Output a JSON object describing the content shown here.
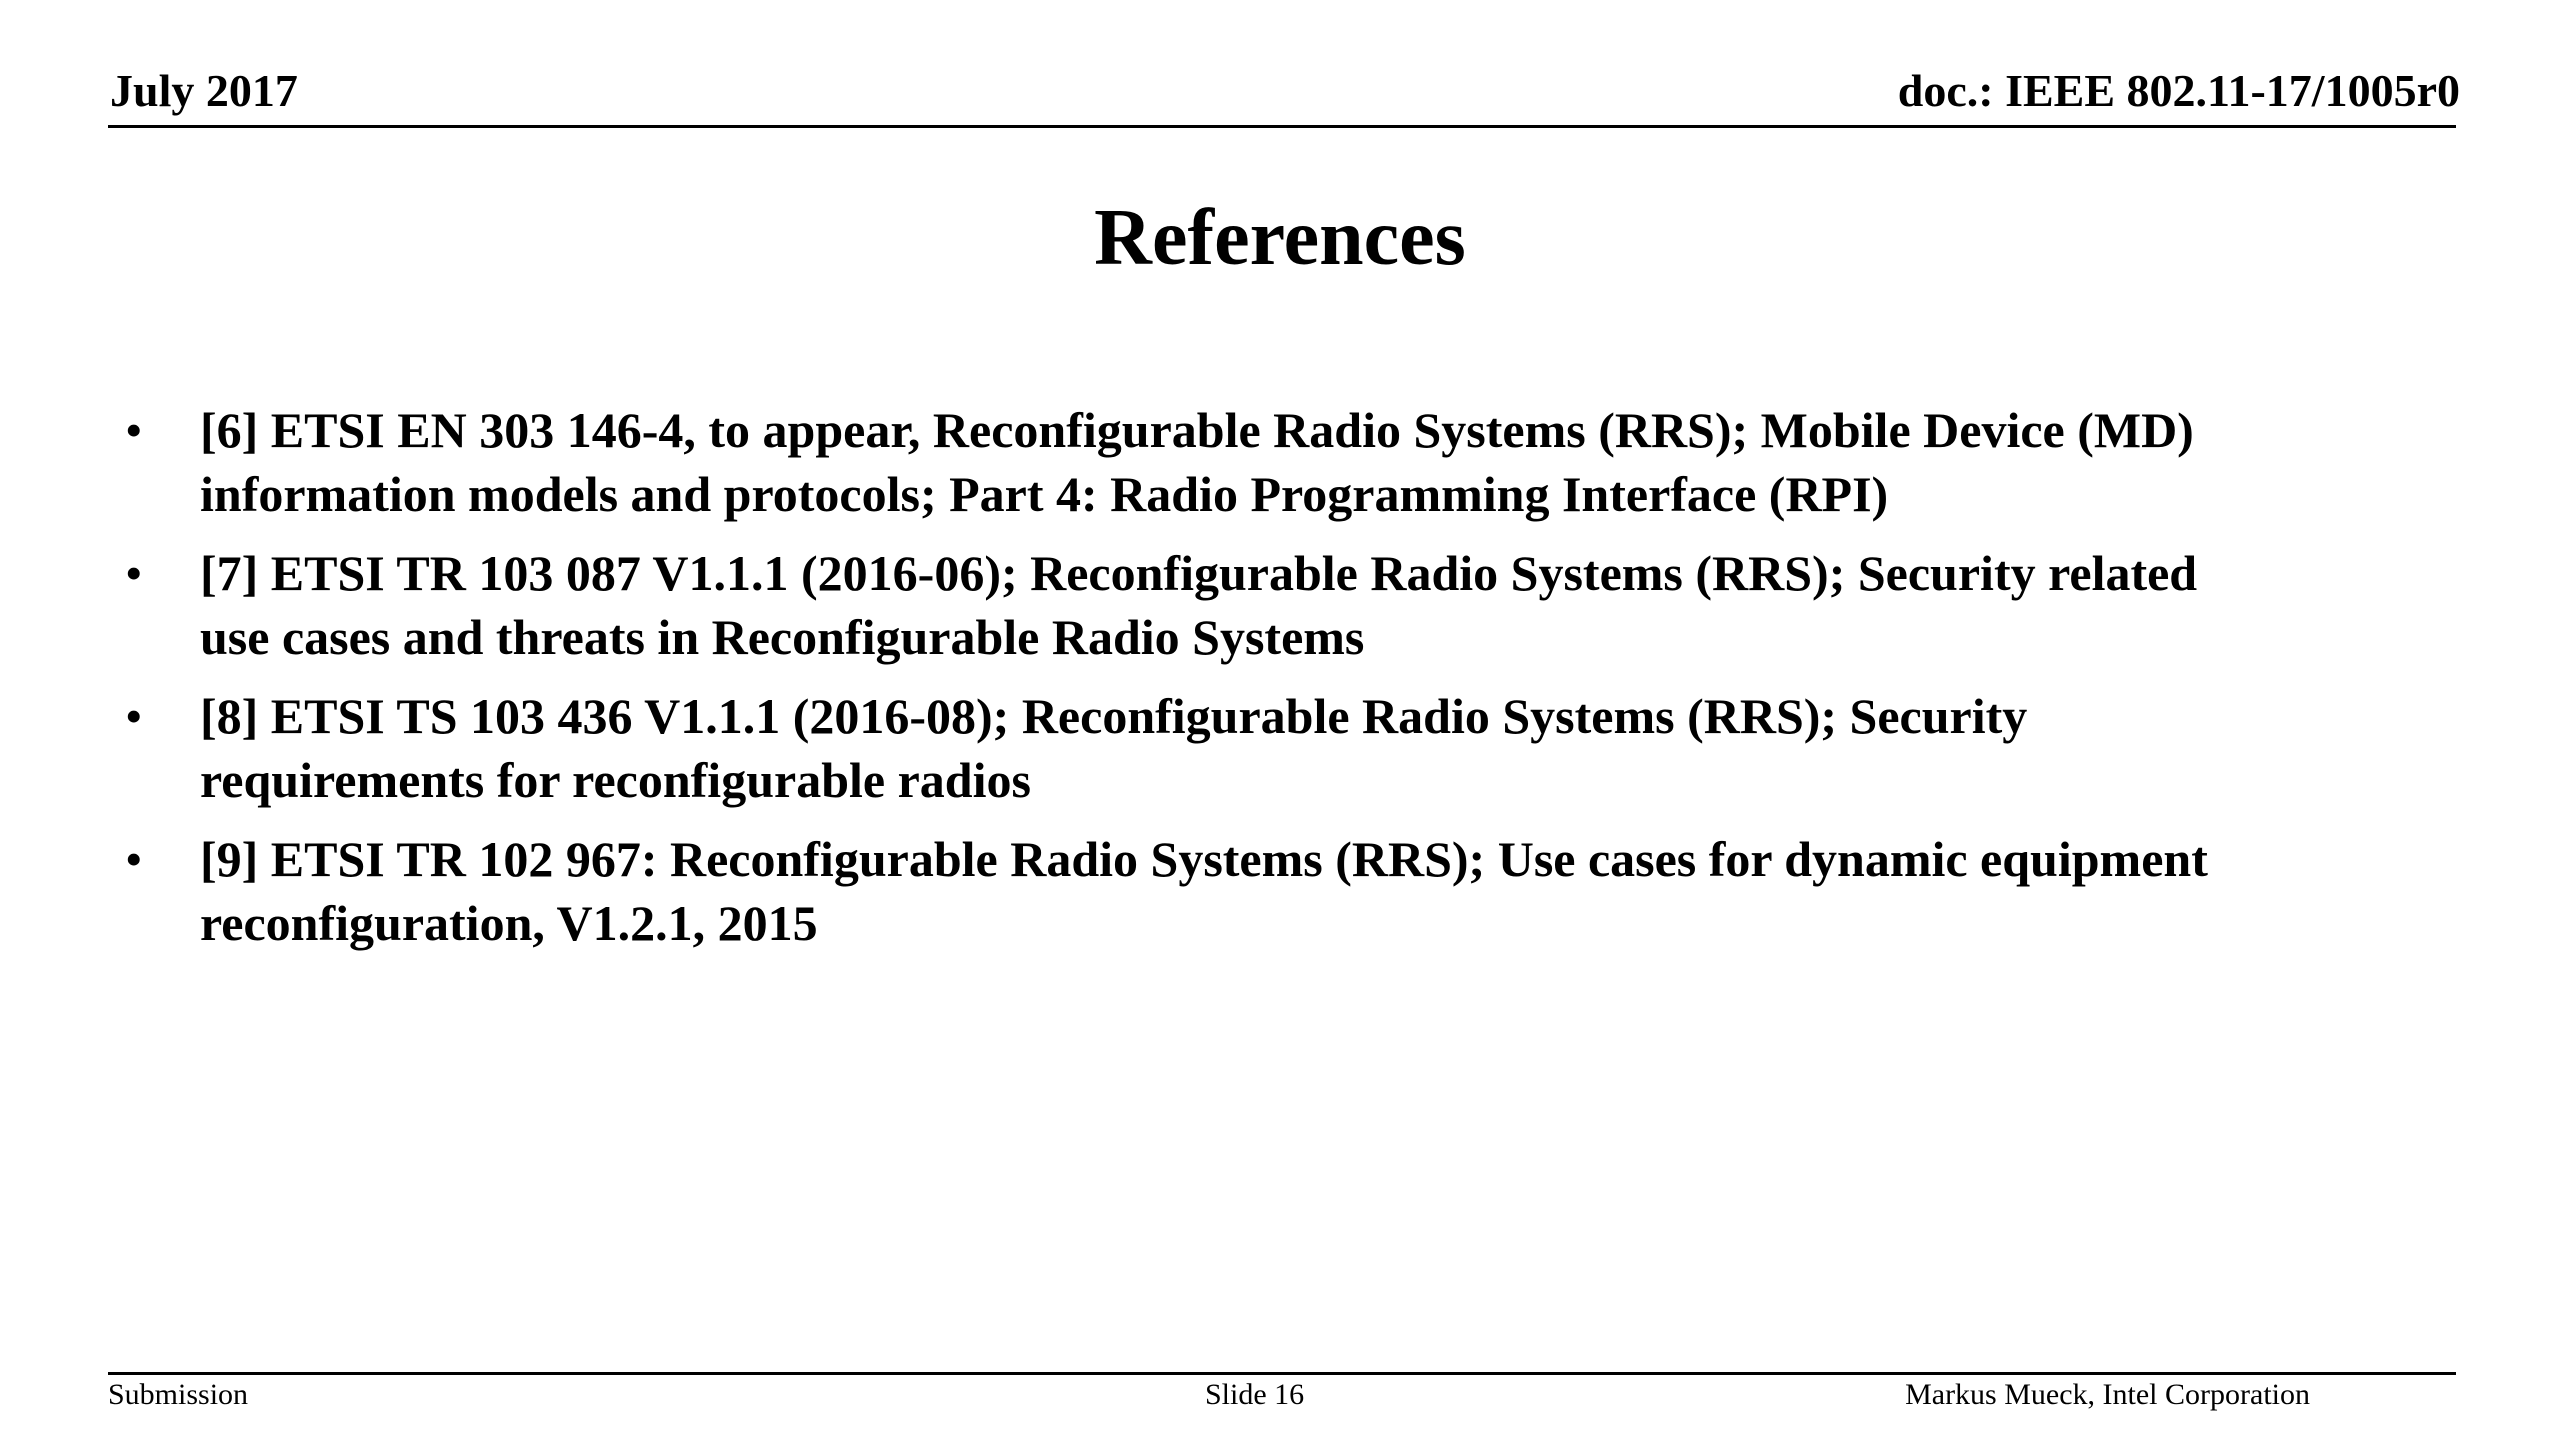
{
  "header": {
    "date": "July 2017",
    "doc_id": "doc.: IEEE 802.11-17/1005r0"
  },
  "title": "References",
  "references": [
    {
      "line1": "[6] ETSI EN 303 146-4, to appear, Reconfigurable Radio Systems (RRS); Mobile Device (MD)",
      "line2": "information models and protocols; Part 4: Radio Programming Interface (RPI)"
    },
    {
      "line1": "[7] ETSI TR 103 087 V1.1.1 (2016-06); Reconfigurable Radio Systems (RRS); Security related",
      "line2": "use cases and threats in Reconfigurable Radio Systems"
    },
    {
      "line1": "[8] ETSI TS 103 436 V1.1.1 (2016-08); Reconfigurable Radio Systems (RRS); Security",
      "line2": "requirements for reconfigurable radios"
    },
    {
      "line1": "[9] ETSI TR 102 967: Reconfigurable Radio Systems (RRS); Use cases for dynamic equipment",
      "line2": "reconfiguration, V1.2.1, 2015"
    }
  ],
  "bullet_glyph": "•",
  "footer": {
    "left": "Submission",
    "center": "Slide 16",
    "right": "Markus Mueck, Intel Corporation"
  }
}
